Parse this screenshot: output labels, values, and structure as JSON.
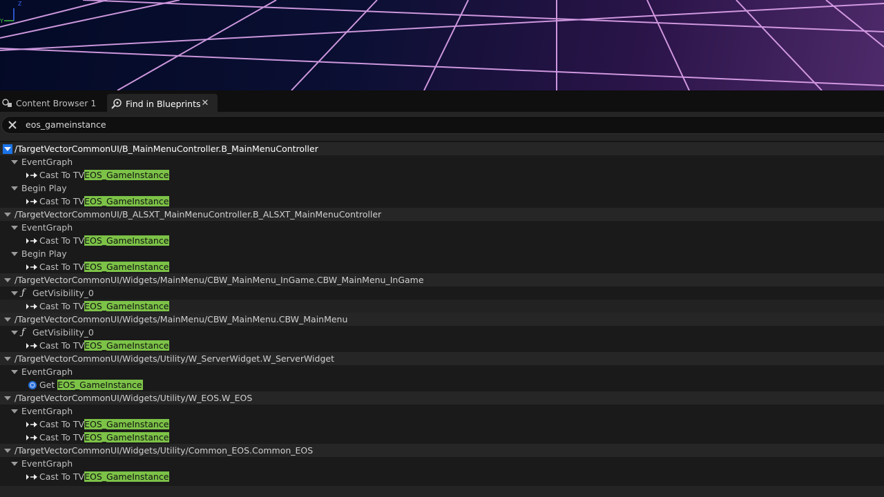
{
  "tabs": [
    {
      "label": "Content Browser 1",
      "icon": "content-browser-icon",
      "active": false
    },
    {
      "label": "Find in Blueprints",
      "icon": "find-blueprints-icon",
      "active": true
    }
  ],
  "search": {
    "value": "eos_gameinstance"
  },
  "highlight_color": "#7cc247",
  "selection_color": "#1a73e8",
  "results": {
    "r0": {
      "label": "/TargetVectorCommonUI/B_MainMenuController.B_MainMenuController"
    },
    "r1": {
      "label": "EventGraph"
    },
    "r2": {
      "prefix": "Cast To TV",
      "match": "EOS_GameInstance"
    },
    "r3": {
      "label": "Begin Play"
    },
    "r4": {
      "prefix": "Cast To TV",
      "match": "EOS_GameInstance"
    },
    "r5": {
      "label": "/TargetVectorCommonUI/B_ALSXT_MainMenuController.B_ALSXT_MainMenuController"
    },
    "r6": {
      "label": "EventGraph"
    },
    "r7": {
      "prefix": "Cast To TV",
      "match": "EOS_GameInstance"
    },
    "r8": {
      "label": "Begin Play"
    },
    "r9": {
      "prefix": "Cast To TV",
      "match": "EOS_GameInstance"
    },
    "r10": {
      "label": "/TargetVectorCommonUI/Widgets/MainMenu/CBW_MainMenu_InGame.CBW_MainMenu_InGame"
    },
    "r11": {
      "label": "GetVisibility_0"
    },
    "r12": {
      "prefix": "Cast To TV",
      "match": "EOS_GameInstance"
    },
    "r13": {
      "label": "/TargetVectorCommonUI/Widgets/MainMenu/CBW_MainMenu.CBW_MainMenu"
    },
    "r14": {
      "label": "GetVisibility_0"
    },
    "r15": {
      "prefix": "Cast To TV",
      "match": "EOS_GameInstance"
    },
    "r16": {
      "label": "/TargetVectorCommonUI/Widgets/Utility/W_ServerWidget.W_ServerWidget"
    },
    "r17": {
      "label": "EventGraph"
    },
    "r18": {
      "prefix": "Get ",
      "match": "EOS_GameInstance"
    },
    "r19": {
      "label": "/TargetVectorCommonUI/Widgets/Utility/W_EOS.W_EOS"
    },
    "r20": {
      "label": "EventGraph"
    },
    "r21": {
      "prefix": "Cast To TV",
      "match": "EOS_GameInstance"
    },
    "r22": {
      "prefix": "Cast To TV",
      "match": "EOS_GameInstance"
    },
    "r23": {
      "label": "/TargetVectorCommonUI/Widgets/Utility/Common_EOS.Common_EOS"
    },
    "r24": {
      "label": "EventGraph"
    },
    "r25": {
      "prefix": "Cast To TV",
      "match": "EOS_GameInstance"
    }
  }
}
